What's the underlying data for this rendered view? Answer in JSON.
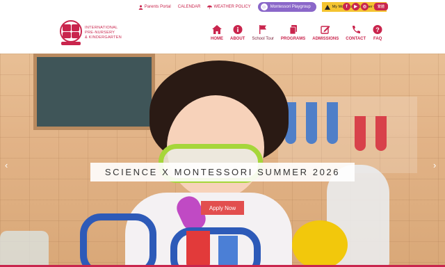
{
  "topbar": {
    "parents_portal": "Parents Portal",
    "calendar": "CALENDAR",
    "weather_policy": "WEATHER POLICY",
    "playgroup": "Montessori Playgroup",
    "summer_camp": "My Montessori Summer Camp",
    "social": {
      "facebook": "f",
      "youtube": "▶",
      "instagram": "◎"
    },
    "language": "繁體"
  },
  "logo": {
    "line1": "INTERNATIONAL",
    "line2": "PRE-NURSERY",
    "line3": "& KINDERGARTEN"
  },
  "nav": {
    "items": [
      {
        "label": "HOME",
        "icon": "home-icon"
      },
      {
        "label": "ABOUT",
        "icon": "info-icon"
      },
      {
        "label": "School Tour",
        "icon": "flag-icon"
      },
      {
        "label": "PROGRAMS",
        "icon": "copy-icon"
      },
      {
        "label": "ADMISSIONS",
        "icon": "edit-icon"
      },
      {
        "label": "CONTACT",
        "icon": "phone-icon"
      },
      {
        "label": "FAQ",
        "icon": "question-icon"
      }
    ]
  },
  "hero": {
    "caption": "SCIENCE X MONTESSORI SUMMER 2026",
    "cta": "Apply Now",
    "prev": "‹",
    "next": "›"
  },
  "colors": {
    "brand": "#c9254d",
    "playgroup": "#8a67c9",
    "summer": "#f4c430",
    "cta": "#e24e4e"
  }
}
